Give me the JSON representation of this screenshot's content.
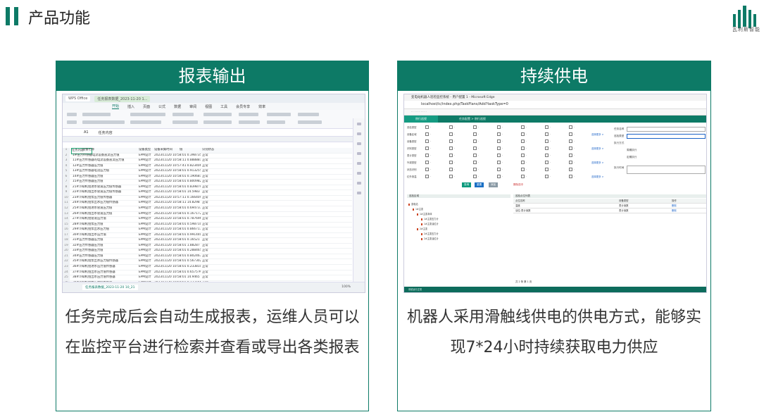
{
  "page": {
    "title": "产品功能",
    "logo_text": "瓦利斯智能",
    "accent": "#0d7a66"
  },
  "cards": [
    {
      "title": "报表输出",
      "description": "任务完成后会自动生成报表，运维人员可以在监控平台进行检索并查看或导出各类报表"
    },
    {
      "title": "持续供电",
      "description": "机器人采用滑触线供电的供电方式，能够实现7*24小时持续获取电力供应"
    }
  ],
  "spreadsheet": {
    "tabs": [
      "WPS Office",
      "任务报表数据_2023-11-20 1..."
    ],
    "menu": [
      "开始",
      "插入",
      "页面",
      "公式",
      "数据",
      "审阅",
      "视图",
      "工具",
      "会员专享",
      "效率"
    ],
    "menu_active": "开始",
    "cell_ref": "A1",
    "formula": "任务内容",
    "header_row": [
      "任务内容",
      "设备名称",
      "设备类型",
      "设备采集时间",
      "值",
      "识别状态"
    ],
    "rows": [
      [
        "1#压力传感器电流设备直流压力值",
        "EPM设计",
        "2023/11/20 10:58:01 0.398735 MPa",
        "正常"
      ],
      [
        "11#压力传感器的电流设备直流压力值",
        "EPM设计",
        "2023/11/20 10:58:11 0.888881 MPa",
        "正常"
      ],
      [
        "12#压力传感器压力值",
        "EPM设计",
        "2023/11/20 10:57:41 0.8234067 MPa",
        "正常"
      ],
      [
        "13#压力传感器电流压力值",
        "EPM设计",
        "2023/11/20 10:58:01 0.9132557 MPa",
        "正常"
      ],
      [
        "14#压力传感器压力值",
        "EPM设计",
        "2023/11/20 10:58:01 0.190681 MPa",
        "正常"
      ],
      [
        "15#压力传感器压力值",
        "EPM设计",
        "2023/11/20 10:58:01 0.8009821 MPa",
        "正常"
      ],
      [
        "21#冷却机组进水管道压力值传感器",
        "EPM设计",
        "2023/11/20 10:58:01 0.839879 MPa",
        "正常"
      ],
      [
        "22#冷却机组出水管道压力值传感器",
        "EPM设计",
        "2023/11/20 10:58:01 14.5983 MPa",
        "正常"
      ],
      [
        "23#冷却机组泵压力值传感器",
        "EPM设计",
        "2023/11/20 10:57:11 0.166409 MPa",
        "正常"
      ],
      [
        "24#冷却机组泵出水压力值传感器",
        "EPM设计",
        "2023/11/20 10:58:11 14.8298 MPa",
        "正常"
      ],
      [
        "25#冷却机组进水管道压力值",
        "EPM设计",
        "2023/11/20 10:58:01 0.694737 MPa",
        "正常"
      ],
      [
        "26#冷却机组出水管道压力值",
        "EPM设计",
        "2023/11/20 10:58:01 0.167172 MPa",
        "正常"
      ],
      [
        "27#冷却机组管道压力值",
        "EPM设计",
        "2023/11/20 10:58:01 0.787696 MPa",
        "正常"
      ],
      [
        "28#冷却机组泵压力值",
        "EPM设计",
        "2023/11/20 10:58:01 0.598710 MPa",
        "正常"
      ],
      [
        "29#冷却机组泵出水压力值",
        "EPM设计",
        "2023/11/20 10:58:01 0.866717 MPa",
        "正常"
      ],
      [
        "30#冷却机组出水压力值",
        "EPM设计",
        "2023/11/20 10:58:01 0.9914409 MPa",
        "正常"
      ],
      [
        "31#压力传感器压力值",
        "EPM设计",
        "2023/11/20 10:58:01 0.16521 MPa",
        "正常"
      ],
      [
        "32#压力传感器压力值",
        "EPM设计",
        "2023/11/20 10:58:01 1.88287 MPa",
        "正常"
      ],
      [
        "33#压力传感器压力值",
        "EPM设计",
        "2023/11/20 10:58:01 0.288465 MPa",
        "正常"
      ],
      [
        "34#压力传感器压力值",
        "EPM设计",
        "2023/11/20 10:58:01 0.8024635 MPa",
        "正常"
      ],
      [
        "35#冷却机组泵出水压力值传感器",
        "EPM设计",
        "2023/11/20 10:58:01 0.5673021 MPa",
        "正常"
      ],
      [
        "36#冷却机组进水压力值传感器",
        "EPM设计",
        "2023/11/20 10:58:01 0.233810 MPa",
        "正常"
      ],
      [
        "37#冷却机组出水压力值传感器",
        "EPM设计",
        "2023/11/20 10:58:01 0.6575 MPa",
        "正常"
      ],
      [
        "38#冷却机组出水压力值传感器",
        "EPM设计",
        "2023/11/20 10:58:01 14.9465 MPa",
        "正常"
      ],
      [
        "39#冷却机组泵压力值传感器",
        "EPM设计",
        "2023/11/20 10:58:01 0.177166 MPa",
        "正常"
      ],
      [
        "40#冷却机组出水管道压力值",
        "EPM设计",
        "2023/11/20 10:58:01 0.398236 MPa",
        "正常"
      ],
      [
        "41#冷却机组进水管道压力值",
        "EPM设计",
        "2023/11/20 10:58:01 0.222396 MPa",
        "正常"
      ],
      [
        "42#冷却机组泵出水压力值",
        "EPM设计",
        "2023/11/20 10:58:01 0.719905 MPa",
        "正常"
      ]
    ],
    "sheet_tab": "任务报表数据_2023-11-20 10_21",
    "zoom": "100%"
  },
  "browser": {
    "title": "变电站机器人巡检监控系统 - 用户配置 1 - Microsoft Edge",
    "address": "localhost/ic/index.php/TaskPlans/Add?taskType=0",
    "app_tabs": [
      "例行巡视",
      "任务配置 > 例行巡视"
    ],
    "filter_labels": [
      "巡检类型",
      "设备区域",
      "设备类型",
      "识别类型",
      "表计类型",
      "外观类型",
      "状态识别",
      "红外测温"
    ],
    "more": "选择更多 >",
    "right_form": [
      "任务名称",
      "巡检类型",
      "执行方式",
      "周期执行",
      "定期执行",
      "执行时间"
    ],
    "buttons": [
      "查询",
      "重置",
      "添加",
      "删除选中"
    ],
    "tree_header": "巡检区域",
    "tree_nodes": [
      "变电站",
      "1#主变",
      "1#主变本体",
      "1#主变压力计",
      "1#主变油位计",
      "2#主变",
      "2#主变压力计",
      "2#主变油位计"
    ],
    "grid_header": "巡检点位列表",
    "grid_cols": [
      "点位名称",
      "设备类型",
      "操作"
    ],
    "grid_rows": [
      [
        "温度",
        "表计读数",
        "删除"
      ],
      [
        "油位-表计读数",
        "表计读数",
        "删除"
      ]
    ],
    "pager": "共 2 条 第 1 页",
    "taskbar": "系统运行正常"
  }
}
